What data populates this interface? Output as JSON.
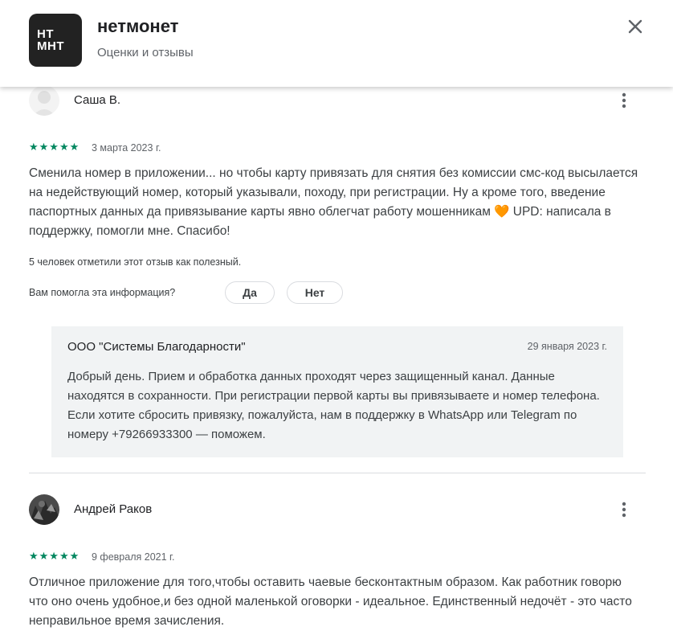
{
  "app": {
    "icon_text_line1": "НТ",
    "icon_text_line2": "МНТ",
    "title": "нетмонет",
    "subtitle": "Оценки и отзывы",
    "close_icon": "close-icon"
  },
  "reviews": [
    {
      "user_name": "Саша В.",
      "stars": "★★★★★",
      "rating": 5,
      "date": "3 марта 2023 г.",
      "text": "Сменила номер в приложении... но чтобы карту привязать для снятия без комиссии смс-код высылается на недействующий номер, который указывали, походу, при регистрации. Ну а кроме того, введение паспортных данных да привязывание карты явно облегчат работу мошенникам 🧡 UPD: написала в поддержку, помогли мне. Спасибо!",
      "helpful_count": "5 человек отметили этот отзыв как полезный.",
      "helpful_question": "Вам помогла эта информация?",
      "yes_label": "Да",
      "no_label": "Нет",
      "reply": {
        "developer": "ООО \"Системы Благодарности\"",
        "date": "29 января 2023 г.",
        "text": "Добрый день. Прием и обработка данных проходят через защищенный канал. Данные находятся в сохранности. При регистрации первой карты вы привязываете и номер телефона. Если хотите сбросить привязку, пожалуйста, нам в поддержку в WhatsApp или Telegram по номеру +79266933300 — поможем."
      }
    },
    {
      "user_name": "Андрей Раков",
      "stars": "★★★★★",
      "rating": 5,
      "date": "9 февраля 2021 г.",
      "text": "Отличное приложение для того,чтобы оставить чаевые бесконтактным образом. Как работник говорю что оно очень удобное,и без одной маленькой оговорки - идеальное. Единственный недочёт - это часто неправильное время зачисления."
    }
  ],
  "colors": {
    "star_green": "#01875f",
    "reply_bg": "#f1f3f4",
    "header_icon_bg": "#222222"
  }
}
